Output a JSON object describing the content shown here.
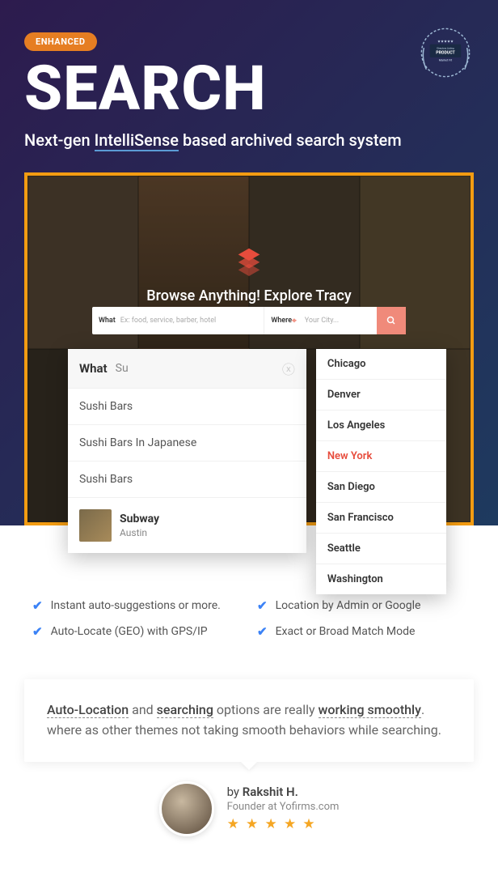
{
  "enhanced_badge": "ENHANCED",
  "product_badge": {
    "line1": "Directory Listing",
    "word": "PRODUCT",
    "line2": "Market Fit"
  },
  "title": "SEARCH",
  "subtitle_pre": "Next-gen ",
  "subtitle_intelli": "IntelliSense",
  "subtitle_post": " based archived search system",
  "demo": {
    "browse": "Browse Anything! Explore Tracy",
    "bar": {
      "what_label": "What",
      "what_placeholder": "Ex: food, service, barber, hotel",
      "where_label": "Where",
      "where_placeholder": "Your City..."
    },
    "what_dropdown": {
      "label": "What",
      "query": "Su",
      "items": [
        "Sushi Bars",
        "Sushi Bars In Japanese",
        "Sushi Bars"
      ],
      "rich": {
        "title": "Subway",
        "sub": "Austin"
      }
    },
    "where_dropdown": {
      "cities": [
        "Chicago",
        "Denver",
        "Los Angeles",
        "New York",
        "San Diego",
        "San Francisco",
        "Seattle",
        "Washington"
      ],
      "active": "New York"
    }
  },
  "features": [
    "Instant auto-suggestions or more.",
    "Location by Admin or Google",
    "Auto-Locate (GEO) with GPS/IP",
    "Exact or Broad Match Mode"
  ],
  "testimonial": {
    "u1": "Auto-Location",
    "t1": " and ",
    "u2": "searching",
    "t2": " options are really ",
    "u3": "working smoothly",
    "t3": ". where as other themes not taking smooth behaviors while searching."
  },
  "author": {
    "by_prefix": "by ",
    "name": "Rakshit H.",
    "role": "Founder at Yofirms.com",
    "stars": "★ ★ ★ ★ ★"
  }
}
